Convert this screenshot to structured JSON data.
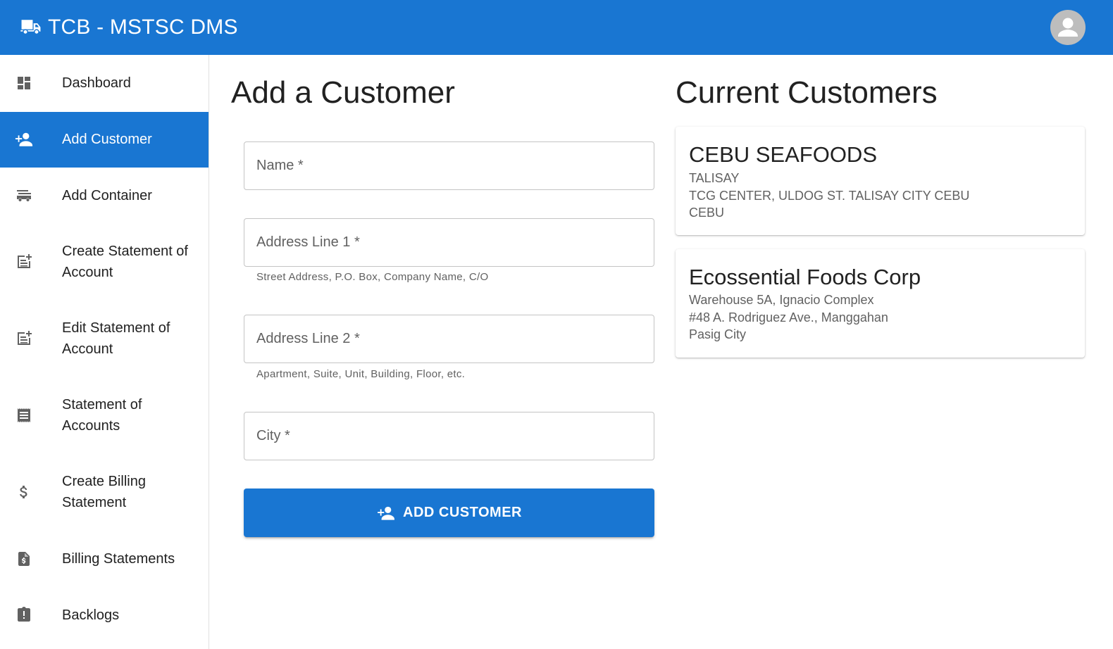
{
  "app": {
    "title": "TCB - MSTSC DMS",
    "brand_color": "#1976d2",
    "logo_icon": "truck-icon",
    "account_icon": "account-circle-icon"
  },
  "sidebar": {
    "items": [
      {
        "label": "Dashboard",
        "icon": "dashboard-icon",
        "active": false
      },
      {
        "label": "Add Customer",
        "icon": "person-add-icon",
        "active": true
      },
      {
        "label": "Add Container",
        "icon": "container-icon",
        "active": false
      },
      {
        "label": "Create Statement of Account",
        "icon": "post-add-icon",
        "active": false
      },
      {
        "label": "Edit Statement of Account",
        "icon": "post-add-icon",
        "active": false
      },
      {
        "label": "Statement of Accounts",
        "icon": "receipt-icon",
        "active": false
      },
      {
        "label": "Create Billing Statement",
        "icon": "dollar-icon",
        "active": false
      },
      {
        "label": "Billing Statements",
        "icon": "request-quote-icon",
        "active": false
      },
      {
        "label": "Backlogs",
        "icon": "assignment-late-icon",
        "active": false
      }
    ]
  },
  "form": {
    "heading": "Add a Customer",
    "fields": {
      "name": {
        "placeholder": "Name *",
        "value": ""
      },
      "address1": {
        "placeholder": "Address Line 1 *",
        "value": "",
        "helper": "Street Address, P.O. Box, Company Name, C/O"
      },
      "address2": {
        "placeholder": "Address Line 2 *",
        "value": "",
        "helper": "Apartment, Suite, Unit, Building, Floor, etc."
      },
      "city": {
        "placeholder": "City *",
        "value": ""
      }
    },
    "submit_label": "ADD CUSTOMER"
  },
  "customers": {
    "heading": "Current Customers",
    "list": [
      {
        "name": "CEBU SEAFOODS",
        "lines": [
          "TALISAY",
          "TCG CENTER, ULDOG ST. TALISAY CITY CEBU",
          "CEBU"
        ]
      },
      {
        "name": "Ecossential Foods Corp",
        "lines": [
          "Warehouse 5A, Ignacio Complex",
          "#48 A. Rodriguez Ave., Manggahan",
          "Pasig City"
        ]
      }
    ]
  }
}
